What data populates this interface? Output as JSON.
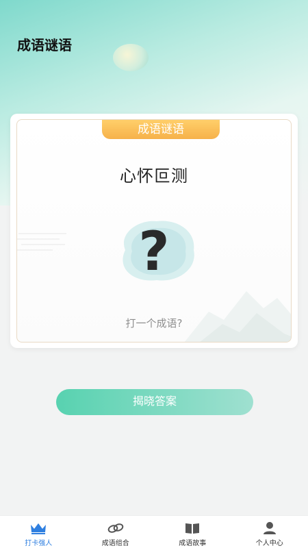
{
  "header": {
    "title": "成语谜语"
  },
  "card": {
    "tab_label": "成语谜语",
    "riddle": "心怀叵测",
    "question_mark": "?",
    "hint": "打一个成语?"
  },
  "actions": {
    "reveal_label": "揭晓答案"
  },
  "tabbar": {
    "items": [
      {
        "label": "打卡强人",
        "icon": "crown-icon",
        "active": true
      },
      {
        "label": "成语组合",
        "icon": "link-icon",
        "active": false
      },
      {
        "label": "成语故事",
        "icon": "book-icon",
        "active": false
      },
      {
        "label": "个人中心",
        "icon": "person-icon",
        "active": false
      }
    ]
  },
  "colors": {
    "accent": "#2f7fe0",
    "button_start": "#58d2b0",
    "button_end": "#9fe0d0",
    "tab_orange": "#f6b14a"
  }
}
